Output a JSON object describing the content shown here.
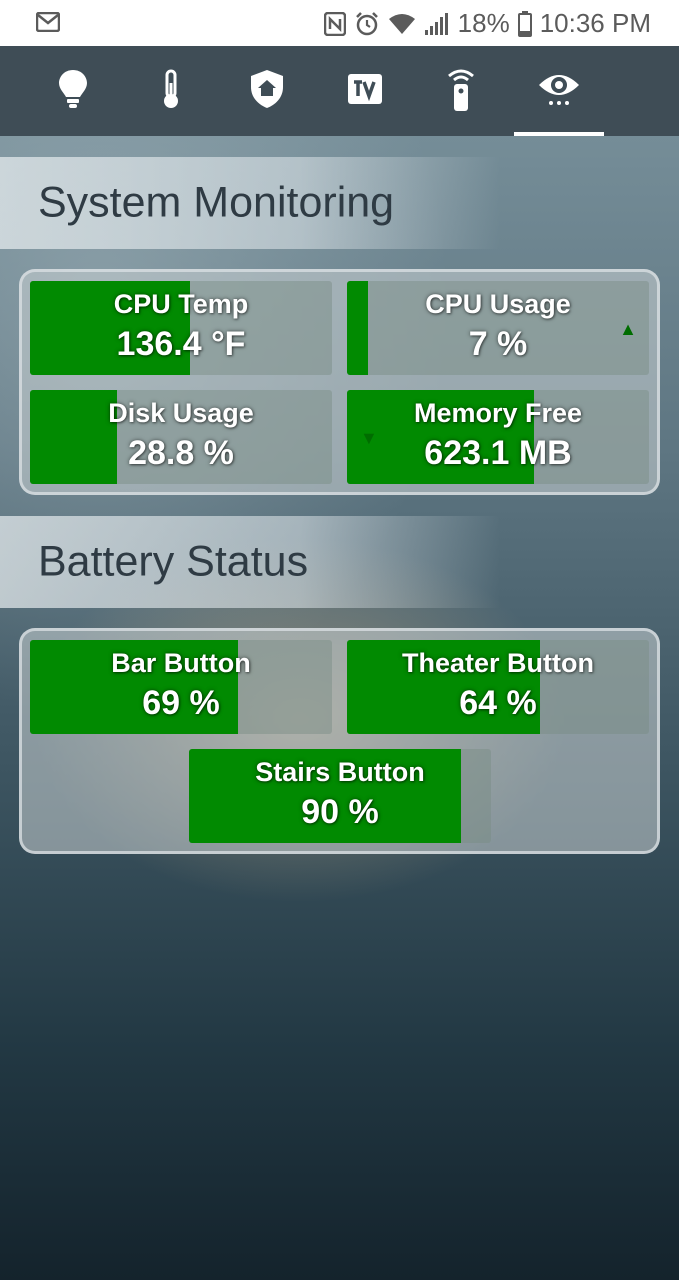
{
  "status_bar": {
    "battery": "18%",
    "time": "10:36 PM"
  },
  "tabs": [
    {
      "name": "lightbulb",
      "active": false
    },
    {
      "name": "thermometer",
      "active": false
    },
    {
      "name": "security-shield",
      "active": false
    },
    {
      "name": "tv",
      "active": false
    },
    {
      "name": "remote",
      "active": false
    },
    {
      "name": "eye",
      "active": true
    }
  ],
  "system_monitoring": {
    "title": "System Monitoring",
    "tiles": [
      {
        "label": "CPU Temp",
        "value": "136.4 °F",
        "fill": 0.53,
        "trend": ""
      },
      {
        "label": "CPU Usage",
        "value": "7 %",
        "fill": 0.07,
        "trend": "up"
      },
      {
        "label": "Disk Usage",
        "value": "28.8 %",
        "fill": 0.288,
        "trend": ""
      },
      {
        "label": "Memory Free",
        "value": "623.1 MB",
        "fill": 0.62,
        "trend": "down"
      }
    ]
  },
  "battery_status": {
    "title": "Battery Status",
    "tiles": [
      {
        "label": "Bar Button",
        "value": "69 %",
        "fill": 0.69
      },
      {
        "label": "Theater Button",
        "value": "64 %",
        "fill": 0.64
      },
      {
        "label": "Stairs Button",
        "value": "90 %",
        "fill": 0.9
      }
    ]
  },
  "colors": {
    "fill_green": "#018a01",
    "appbar": "#3f4d56",
    "trend_green": "#006d00"
  }
}
